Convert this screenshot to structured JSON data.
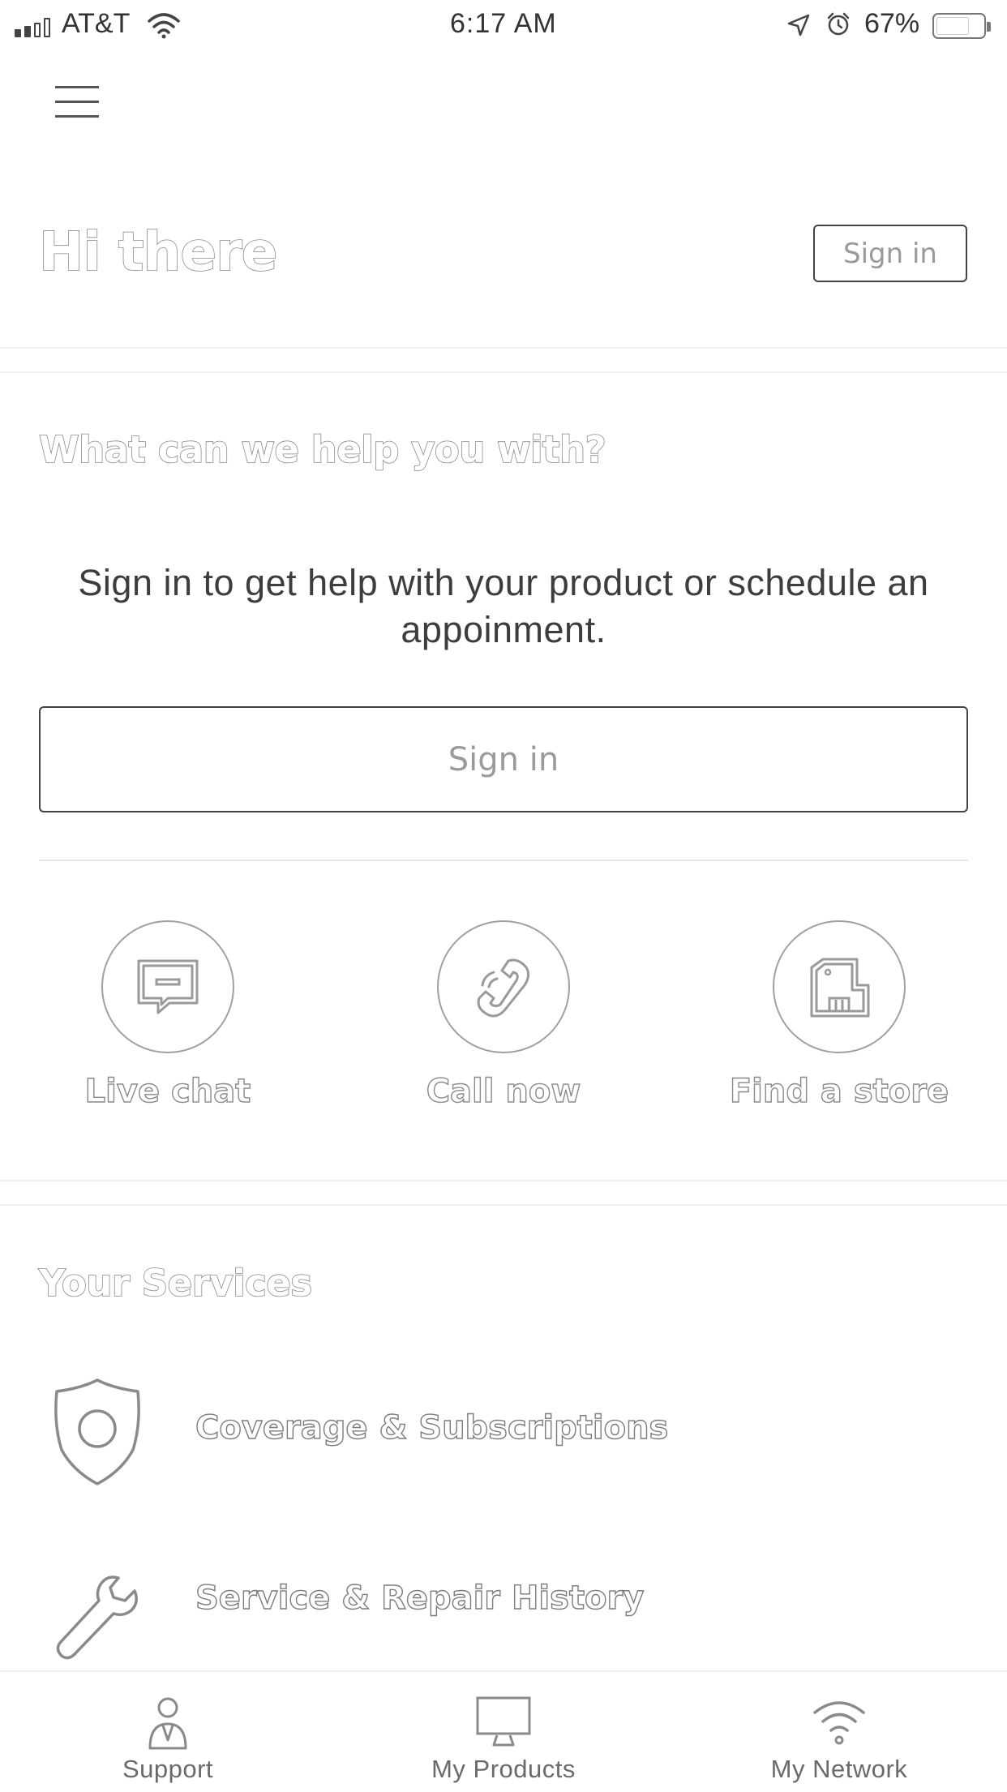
{
  "status_bar": {
    "carrier": "AT&T",
    "time": "6:17 AM",
    "battery": "67%"
  },
  "header": {
    "greeting": "Hi there",
    "sign_in_label": "Sign in"
  },
  "help": {
    "title": "What can we help you with?",
    "description": "Sign in to get help with your product or schedule an appoinment.",
    "sign_in_label": "Sign in",
    "actions": [
      {
        "label": "Live chat",
        "icon": "chat-icon"
      },
      {
        "label": "Call now",
        "icon": "phone-icon"
      },
      {
        "label": "Find a store",
        "icon": "store-icon"
      }
    ]
  },
  "services": {
    "title": "Your Services",
    "items": [
      {
        "label": "Coverage & Subscriptions",
        "icon": "shield-icon"
      },
      {
        "label": "Service & Repair History",
        "icon": "wrench-icon"
      }
    ]
  },
  "tabbar": {
    "tabs": [
      {
        "label": "Support",
        "icon": "person-icon"
      },
      {
        "label": "My Products",
        "icon": "monitor-icon"
      },
      {
        "label": "My Network",
        "icon": "wifi-icon"
      }
    ]
  }
}
